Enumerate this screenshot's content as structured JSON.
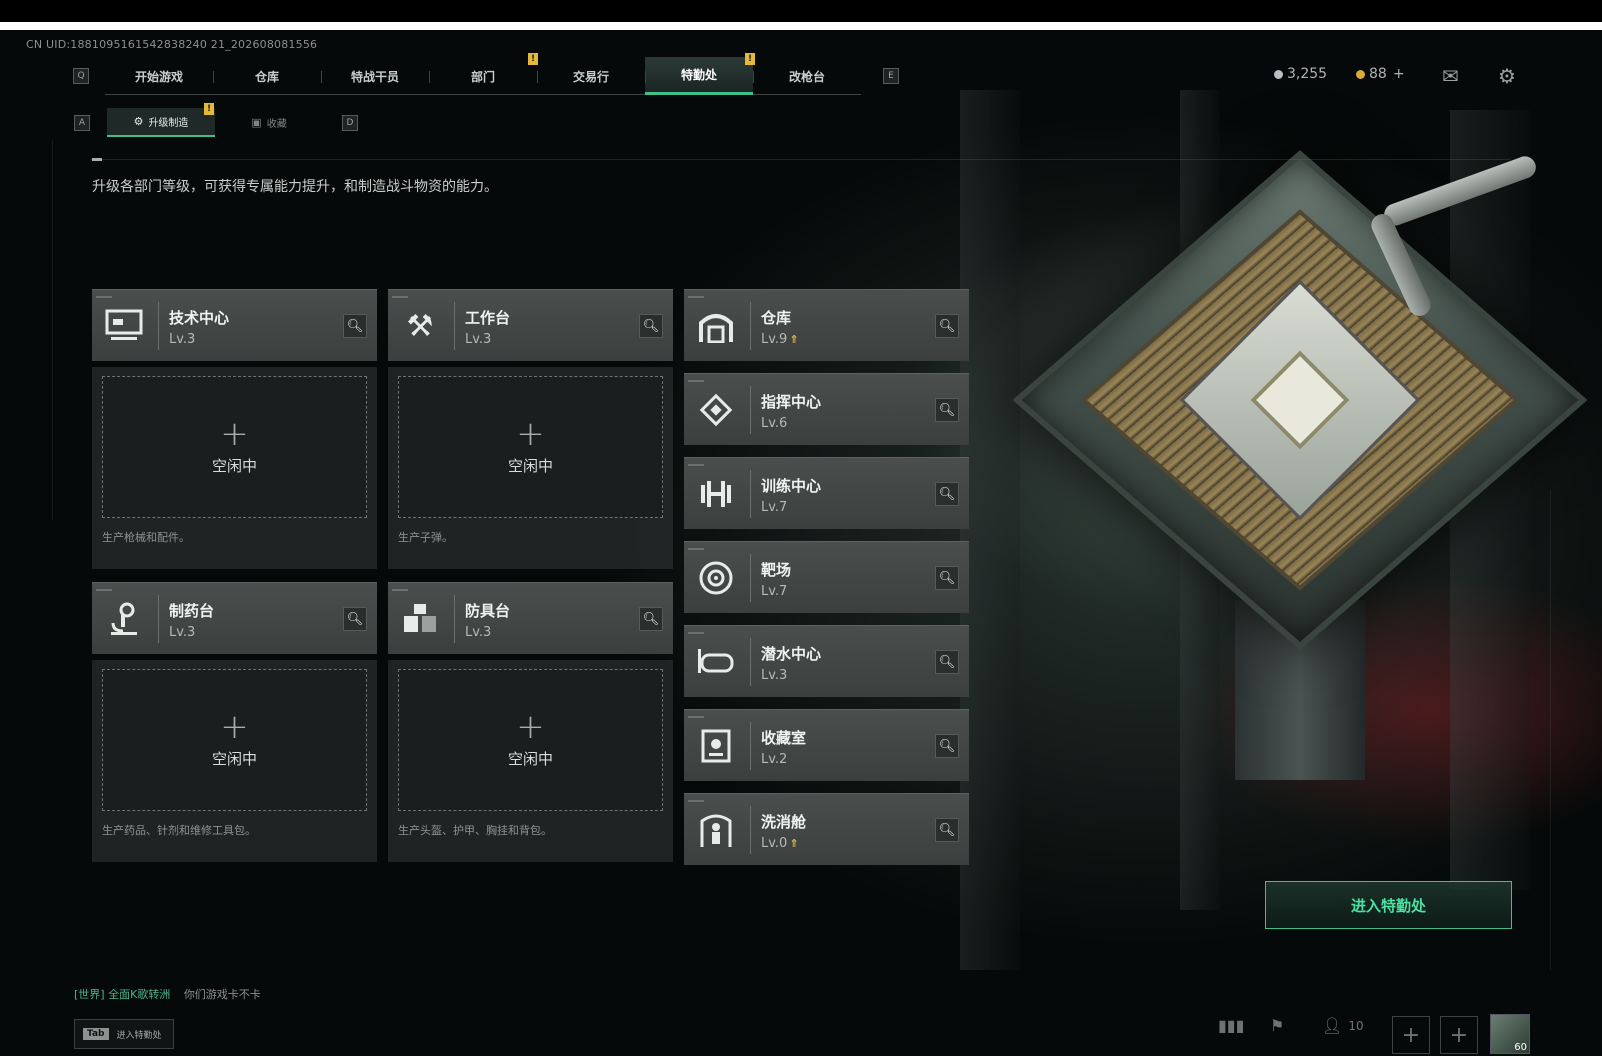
{
  "uid": "CN UID:1881095161542838240 21_202608081556",
  "nav": {
    "left_key": "Q",
    "right_key": "E",
    "tabs": [
      {
        "label": "开始游戏"
      },
      {
        "label": "仓库"
      },
      {
        "label": "特战干员"
      },
      {
        "label": "部门",
        "badge": "!"
      },
      {
        "label": "交易行"
      },
      {
        "label": "特勤处",
        "badge": "!",
        "active": true
      },
      {
        "label": "改枪台"
      }
    ]
  },
  "currency": {
    "silver": "3,255",
    "gold": "88",
    "gold_plus": "+"
  },
  "icons": {
    "mail": "mail-icon",
    "settings": "gear-icon"
  },
  "subnav": {
    "left_key": "A",
    "right_key": "D",
    "tabs": [
      {
        "label": "升级制造",
        "active": true,
        "badge": "!"
      },
      {
        "label": "收藏"
      }
    ]
  },
  "description": "升级各部门等级，可获得专属能力提升，和制造战斗物资的能力。",
  "big_cards": [
    {
      "title": "技术中心",
      "level": "Lv.3",
      "slot": "空闲中",
      "note": "生产枪械和配件。",
      "icon": "computer-icon"
    },
    {
      "title": "工作台",
      "level": "Lv.3",
      "slot": "空闲中",
      "note": "生产子弹。",
      "icon": "tools-icon"
    },
    {
      "title": "制药台",
      "level": "Lv.3",
      "slot": "空闲中",
      "note": "生产药品、针剂和维修工具包。",
      "icon": "microscope-icon"
    },
    {
      "title": "防具台",
      "level": "Lv.3",
      "slot": "空闲中",
      "note": "生产头盔、护甲、胸挂和背包。",
      "icon": "armor-icon"
    }
  ],
  "small_cards": [
    {
      "title": "仓库",
      "level": "Lv.9",
      "upgrade": true,
      "icon": "warehouse-icon"
    },
    {
      "title": "指挥中心",
      "level": "Lv.6",
      "upgrade": false,
      "icon": "command-icon"
    },
    {
      "title": "训练中心",
      "level": "Lv.7",
      "upgrade": false,
      "icon": "dumbbell-icon"
    },
    {
      "title": "靶场",
      "level": "Lv.7",
      "upgrade": false,
      "icon": "target-icon"
    },
    {
      "title": "潜水中心",
      "level": "Lv.3",
      "upgrade": false,
      "icon": "diving-mask-icon"
    },
    {
      "title": "收藏室",
      "level": "Lv.2",
      "upgrade": false,
      "icon": "collection-icon"
    },
    {
      "title": "洗消舱",
      "level": "Lv.0",
      "upgrade": true,
      "icon": "decon-icon"
    }
  ],
  "enter_button": "进入特勤处",
  "chat": {
    "channel": "[世界]",
    "user": "全面K歌转洲",
    "message": "你们游戏卡不卡"
  },
  "tab_hint": {
    "key": "Tab",
    "label": "进入特勤处"
  },
  "bottom": {
    "friends_count": "10",
    "player_level": "60"
  },
  "colors": {
    "accent_green": "#3fbf8c",
    "badge_yellow": "#e4b93a"
  }
}
